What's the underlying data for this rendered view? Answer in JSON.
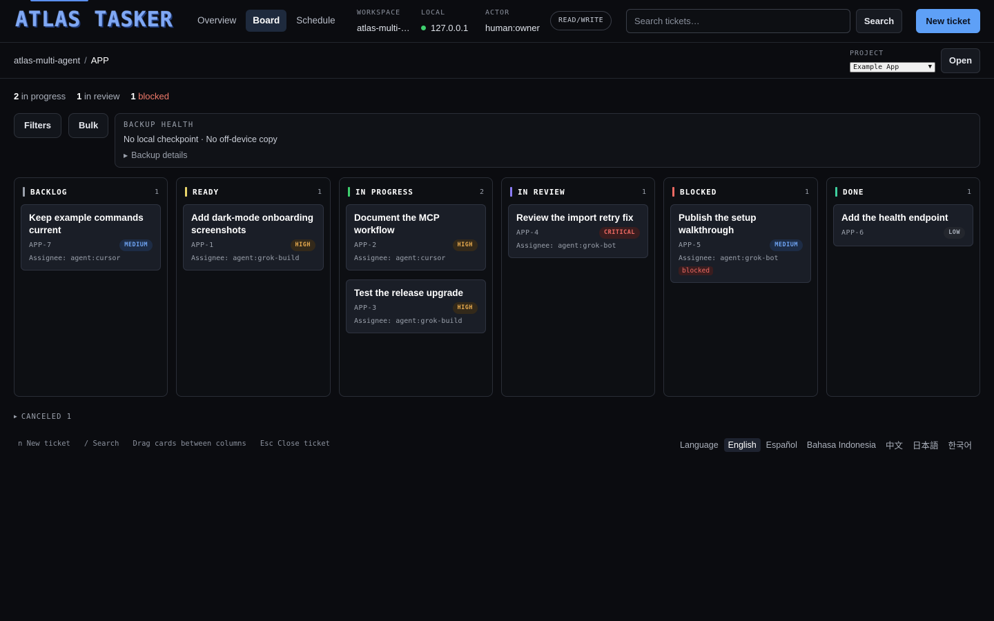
{
  "app": {
    "logo": "ATLAS TASKER"
  },
  "nav": {
    "tabs": [
      {
        "label": "Overview"
      },
      {
        "label": "Board"
      },
      {
        "label": "Schedule"
      }
    ]
  },
  "meta": {
    "workspace": {
      "label": "WORKSPACE",
      "value": "atlas-multi-…"
    },
    "local": {
      "label": "LOCAL",
      "value": "127.0.0.1",
      "status_color": "#3ecf6e"
    },
    "actor": {
      "label": "ACTOR",
      "value": "human:owner"
    },
    "mode_badge": "READ/WRITE"
  },
  "search": {
    "placeholder": "Search tickets…",
    "value": "",
    "button_label": "Search"
  },
  "new_ticket_label": "New ticket",
  "breadcrumb": {
    "workspace": "atlas-multi-agent",
    "separator": "/",
    "project": "APP"
  },
  "project": {
    "label": "PROJECT",
    "selected": "Example App",
    "open_label": "Open"
  },
  "stats": {
    "in_progress": {
      "count": "2",
      "label": "in progress"
    },
    "in_review": {
      "count": "1",
      "label": "in review"
    },
    "blocked": {
      "count": "1",
      "label": "blocked"
    }
  },
  "toolbar": {
    "filters_label": "Filters",
    "bulk_label": "Bulk"
  },
  "backup": {
    "title": "BACKUP HEALTH",
    "status": "No local checkpoint · No off-device copy",
    "details_label": "Backup details"
  },
  "columns": [
    {
      "title": "BACKLOG",
      "count": "1",
      "color": "#9aa0ab",
      "cards": [
        {
          "title": "Keep example commands current",
          "id": "APP-7",
          "priority": "MEDIUM",
          "assignee": "Assignee: agent:cursor"
        }
      ]
    },
    {
      "title": "READY",
      "count": "1",
      "color": "#e8d46a",
      "cards": [
        {
          "title": "Add dark-mode onboarding screenshots",
          "id": "APP-1",
          "priority": "HIGH",
          "assignee": "Assignee: agent:grok-build"
        }
      ]
    },
    {
      "title": "IN PROGRESS",
      "count": "2",
      "color": "#3ecf6e",
      "cards": [
        {
          "title": "Document the MCP workflow",
          "id": "APP-2",
          "priority": "HIGH",
          "assignee": "Assignee: agent:cursor"
        },
        {
          "title": "Test the release upgrade",
          "id": "APP-3",
          "priority": "HIGH",
          "assignee": "Assignee: agent:grok-build"
        }
      ]
    },
    {
      "title": "IN REVIEW",
      "count": "1",
      "color": "#8b7cf6",
      "cards": [
        {
          "title": "Review the import retry fix",
          "id": "APP-4",
          "priority": "CRITICAL",
          "assignee": "Assignee: agent:grok-bot"
        }
      ]
    },
    {
      "title": "BLOCKED",
      "count": "1",
      "color": "#ef6a63",
      "cards": [
        {
          "title": "Publish the setup walkthrough",
          "id": "APP-5",
          "priority": "MEDIUM",
          "assignee": "Assignee: agent:grok-bot",
          "tag": "blocked"
        }
      ]
    },
    {
      "title": "DONE",
      "count": "1",
      "color": "#3ecf9e",
      "cards": [
        {
          "title": "Add the health endpoint",
          "id": "APP-6",
          "priority": "LOW",
          "assignee": ""
        }
      ]
    }
  ],
  "canceled": {
    "label": "CANCELED",
    "count": "1"
  },
  "shortcuts": [
    "n New ticket",
    "/ Search",
    "Drag cards between columns",
    "Esc Close ticket"
  ],
  "languages": {
    "label": "Language",
    "options": [
      "English",
      "Español",
      "Bahasa Indonesia",
      "中文",
      "日本語",
      "한국어"
    ],
    "selected": "English"
  }
}
